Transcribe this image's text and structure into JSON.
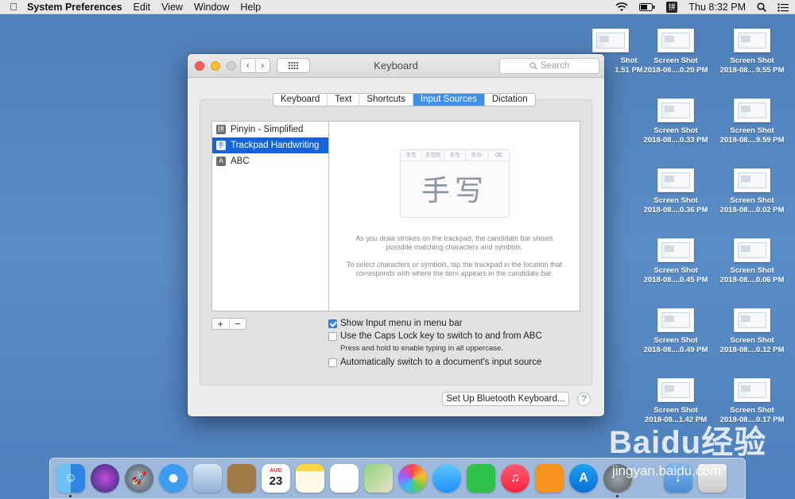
{
  "menubar": {
    "app_name": "System Preferences",
    "items": [
      "Edit",
      "View",
      "Window",
      "Help"
    ],
    "clock": "Thu 8:32 PM",
    "input_badge": "拼"
  },
  "desktop_icons": [
    {
      "line1": "Shot",
      "line2": "1.51 PM"
    },
    {
      "line1": "Screen Shot",
      "line2": "2018-08....0.20 PM"
    },
    {
      "line1": "Screen Shot",
      "line2": "2018-08....9.55 PM"
    },
    {
      "line1": "Screen Shot",
      "line2": "2018-08....0.33 PM"
    },
    {
      "line1": "Screen Shot",
      "line2": "2018-08....9.59 PM"
    },
    {
      "line1": "Screen Shot",
      "line2": "2018-08....0.36 PM"
    },
    {
      "line1": "Screen Shot",
      "line2": "2018-08....0.02 PM"
    },
    {
      "line1": "Screen Shot",
      "line2": "2018-08....0.45 PM"
    },
    {
      "line1": "Screen Shot",
      "line2": "2018-08....0.06 PM"
    },
    {
      "line1": "Screen Shot",
      "line2": "2018-08....0.49 PM"
    },
    {
      "line1": "Screen Shot",
      "line2": "2018-08....0.12 PM"
    },
    {
      "line1": "Screen Shot",
      "line2": "2018-08...1.42 PM"
    },
    {
      "line1": "Screen Shot",
      "line2": "2018-08....0.17 PM"
    }
  ],
  "window": {
    "title": "Keyboard",
    "search_placeholder": "Search",
    "tabs": [
      "Keyboard",
      "Text",
      "Shortcuts",
      "Input Sources",
      "Dictation"
    ],
    "active_tab": "Input Sources",
    "sources": [
      {
        "label": "Pinyin - Simplified",
        "icon": "拼"
      },
      {
        "label": "Trackpad Handwriting",
        "icon": "手"
      },
      {
        "label": "ABC",
        "icon": "A"
      }
    ],
    "selected_source": "Trackpad Handwriting",
    "preview": {
      "candidates": [
        "手写",
        "手写的",
        "手弓",
        "手马",
        "⌫"
      ],
      "glyphs": "手写",
      "desc1": "As you draw strokes on the trackpad, the candidate bar shows possible matching characters and symbols.",
      "desc2": "To select characters or symbols, tap the trackpad in the location that corresponds with where the item appears in the candidate bar."
    },
    "add_label": "+",
    "remove_label": "−",
    "options": {
      "show_menu": {
        "label": "Show Input menu in menu bar",
        "checked": true
      },
      "caps_lock": {
        "label": "Use the Caps Lock key to switch to and from ABC",
        "checked": false
      },
      "caps_hint": "Press and hold to enable typing in all uppercase.",
      "auto_switch": {
        "label": "Automatically switch to a document's input source",
        "checked": false
      }
    },
    "bluetooth_button": "Set Up Bluetooth Keyboard...",
    "help_button": "?"
  },
  "dock": {
    "calendar_month": "AUG",
    "calendar_day": "23"
  },
  "watermark": {
    "brand": "Baidu经验",
    "url": "jingyan.baidu.com"
  }
}
